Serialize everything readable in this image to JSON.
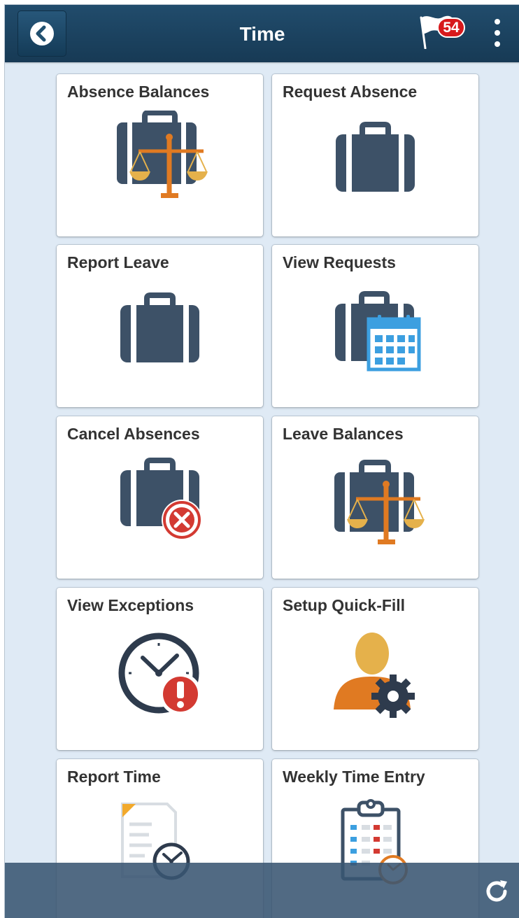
{
  "header": {
    "title": "Time",
    "notifications_count": "54"
  },
  "tiles": [
    {
      "label": "Absence Balances",
      "icon": "briefcase-scales-icon"
    },
    {
      "label": "Request Absence",
      "icon": "briefcase-icon"
    },
    {
      "label": "Report Leave",
      "icon": "briefcase-icon"
    },
    {
      "label": "View Requests",
      "icon": "briefcase-calendar-icon"
    },
    {
      "label": "Cancel Absences",
      "icon": "briefcase-cancel-icon"
    },
    {
      "label": "Leave Balances",
      "icon": "briefcase-scales-icon"
    },
    {
      "label": "View Exceptions",
      "icon": "clock-alert-icon"
    },
    {
      "label": "Setup Quick-Fill",
      "icon": "user-gear-icon"
    },
    {
      "label": "Report Time",
      "icon": "document-clock-icon"
    },
    {
      "label": "Weekly Time Entry",
      "icon": "clipboard-clock-icon"
    }
  ],
  "footer": {
    "refresh_icon": "refresh-icon"
  },
  "colors": {
    "header": "#1f4766",
    "background": "#dfeaf5",
    "briefcase": "#3d5167",
    "accent_orange": "#e07a22",
    "accent_gold": "#e5b14b",
    "alert_red": "#d33a32",
    "calendar_blue": "#3c9fe0"
  }
}
